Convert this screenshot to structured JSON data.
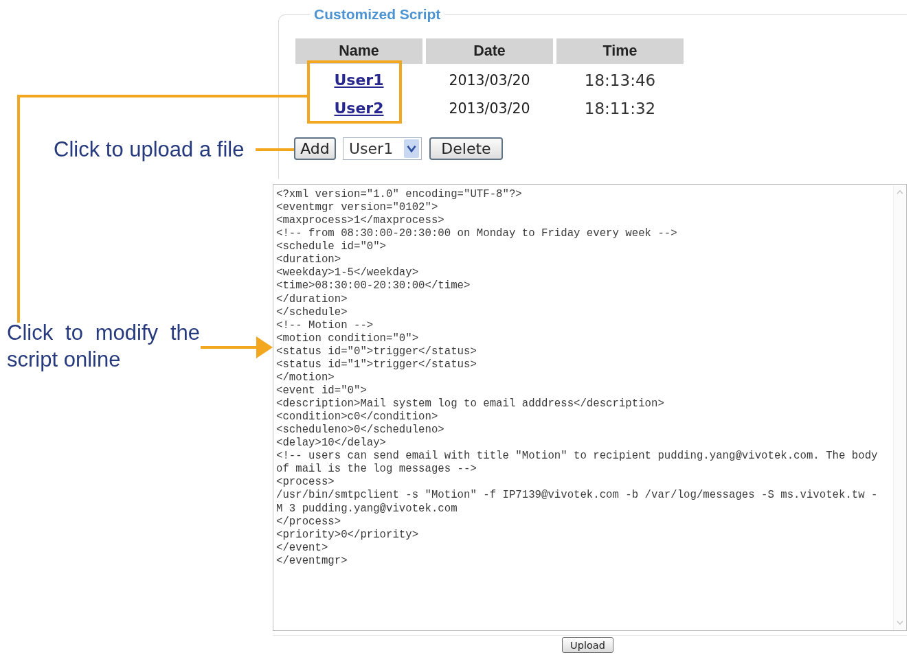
{
  "section": {
    "title": "Customized Script"
  },
  "scripts_table": {
    "columns": [
      "Name",
      "Date",
      "Time"
    ],
    "rows": [
      {
        "name": "User1",
        "date": "2013/03/20",
        "time": "18:13:46"
      },
      {
        "name": "User2",
        "date": "2013/03/20",
        "time": "18:11:32"
      }
    ]
  },
  "actions": {
    "add_button": "Add",
    "script_select": {
      "value": "User1"
    },
    "delete_button": "Delete"
  },
  "editor": {
    "lines": [
      "<?xml version=\"1.0\" encoding=\"UTF-8\"?>",
      "<eventmgr version=\"0102\">",
      "<maxprocess>1</maxprocess>",
      "<!-- from 08:30:00-20:30:00 on Monday to Friday every week -->",
      "<schedule id=\"0\">",
      "<duration>",
      "<weekday>1-5</weekday>",
      "<time>08:30:00-20:30:00</time>",
      "</duration>",
      "</schedule>",
      "<!-- Motion -->",
      "<motion condition=\"0\">",
      "<status id=\"0\">trigger</status>",
      "<status id=\"1\">trigger</status>",
      "</motion>",
      "<event id=\"0\">",
      "<description>Mail system log to email adddress</description>",
      "<condition>c0</condition>",
      "<scheduleno>0</scheduleno>",
      "<delay>10</delay>",
      "<!-- users can send email with title \"Motion\" to recipient pudding.yang@vivotek.com. The body",
      "of mail is the log messages -->",
      "<process>",
      "/usr/bin/smtpclient -s \"Motion\" -f IP7139@vivotek.com -b /var/log/messages -S ms.vivotek.tw -",
      "M 3 pudding.yang@vivotek.com",
      "</process>",
      "<priority>0</priority>",
      "</event>",
      "</eventmgr>"
    ]
  },
  "upload_button": "Upload",
  "callouts": [
    {
      "text": "Click to upload a file"
    },
    {
      "text": "Click to modify the script online"
    }
  ]
}
